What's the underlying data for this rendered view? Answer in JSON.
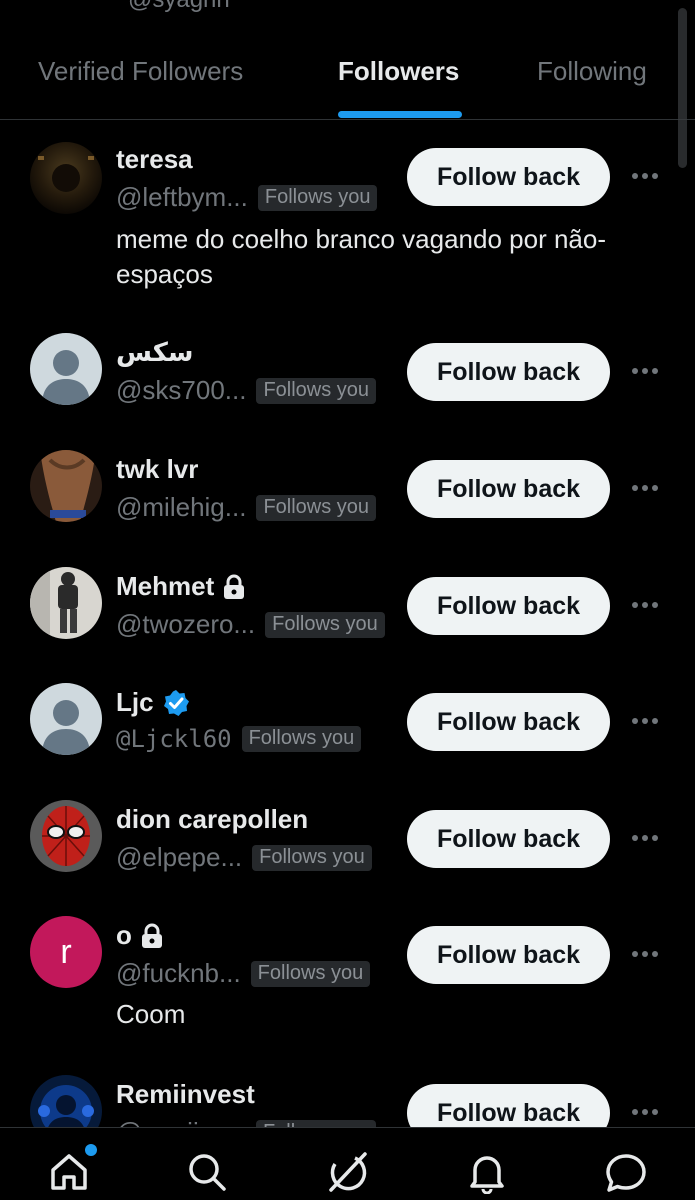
{
  "profile_handle_partial": "@syagnn",
  "tabs": [
    {
      "label": "Verified Followers",
      "active": false
    },
    {
      "label": "Followers",
      "active": true
    },
    {
      "label": "Following",
      "active": false
    }
  ],
  "follow_back_label": "Follow back",
  "follows_you_label": "Follows you",
  "followers": [
    {
      "name": "teresa",
      "handle": "@leftbym...",
      "bio": "meme do coelho branco vagando por não-espaços",
      "badge": null,
      "avatar": "photo-dark"
    },
    {
      "name": "سكس",
      "handle": "@sks700...",
      "bio": "",
      "badge": null,
      "avatar": "default"
    },
    {
      "name": "twk lvr",
      "handle": "@milehig...",
      "bio": "",
      "badge": null,
      "avatar": "photo-skin"
    },
    {
      "name": "Mehmet",
      "handle": "@twozero...",
      "bio": "",
      "badge": "lock-icon",
      "avatar": "photo-light"
    },
    {
      "name": "Ljc",
      "handle": "@Ljckl60",
      "bio": "",
      "badge": "verified-icon",
      "avatar": "default"
    },
    {
      "name": "dion carepollen",
      "handle": "@elpepe...",
      "bio": "",
      "badge": null,
      "avatar": "photo-red"
    },
    {
      "name": "o",
      "handle": "@fucknb...",
      "bio": "Coom",
      "badge": "lock-icon",
      "avatar": "letter",
      "avatar_letter": "r"
    },
    {
      "name": "Remiinvest",
      "handle": "@remiinv...",
      "bio": "",
      "badge": null,
      "avatar": "photo-blue"
    }
  ],
  "bottom_nav": [
    {
      "icon": "home-icon",
      "notification_dot": true
    },
    {
      "icon": "search-icon",
      "notification_dot": false
    },
    {
      "icon": "grok-icon",
      "notification_dot": false
    },
    {
      "icon": "bell-icon",
      "notification_dot": false
    },
    {
      "icon": "messages-icon",
      "notification_dot": false
    }
  ],
  "colors": {
    "background": "#000000",
    "accent": "#1d9bf0",
    "secondary_text": "#71767b",
    "button_bg": "#eff3f4",
    "letter_avatar_bg": "#c2185b"
  }
}
